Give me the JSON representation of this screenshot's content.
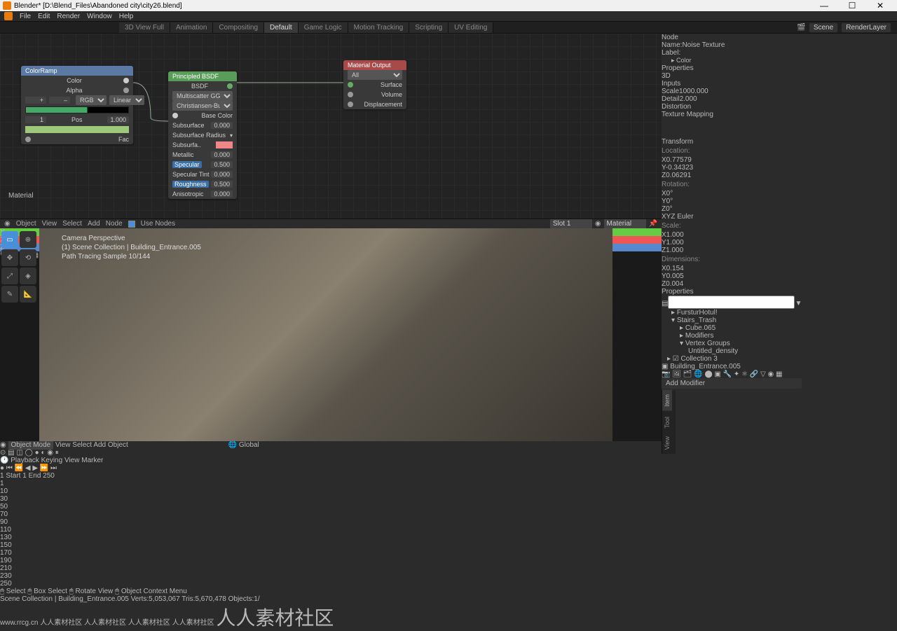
{
  "titlebar": {
    "title": "Blender* [D:\\Blend_Files\\Abandoned city\\city26.blend]",
    "minimize": "—",
    "maximize": "☐",
    "close": "✕"
  },
  "menubar": {
    "file": "File",
    "edit": "Edit",
    "render": "Render",
    "window": "Window",
    "help": "Help"
  },
  "workspaces": {
    "tabs": [
      "3D View Full",
      "Animation",
      "Compositing",
      "Default",
      "Game Logic",
      "Motion Tracking",
      "Scripting",
      "UV Editing"
    ],
    "active": "Default",
    "scene_label": "Scene",
    "scene": "Scene",
    "layer_label": "RenderLayer"
  },
  "nodes": {
    "colorramp": {
      "title": "ColorRamp",
      "color_out": "Color",
      "alpha_out": "Alpha",
      "add": "+",
      "del": "–",
      "mode": "RGB",
      "interp": "Linear",
      "idx": "1",
      "pos_label": "Pos",
      "pos": "1.000",
      "fac": "Fac"
    },
    "principled": {
      "title": "Principled BSDF",
      "bsdf": "BSDF",
      "dist": "Multiscatter GGX",
      "sss": "Christiansen-Burley",
      "base": "Base Color",
      "rows": [
        {
          "l": "Subsurface",
          "v": "0.000"
        },
        {
          "l": "Subsurface Radius",
          "v": ""
        },
        {
          "l": "Subsurfa..",
          "v": "",
          "pink": true
        },
        {
          "l": "Metallic",
          "v": "0.000"
        },
        {
          "l": "Specular",
          "v": "0.500",
          "hl": true
        },
        {
          "l": "Specular Tint",
          "v": "0.000"
        },
        {
          "l": "Roughness",
          "v": "0.500",
          "hl": true
        },
        {
          "l": "Anisotropic",
          "v": "0.000"
        }
      ]
    },
    "matout": {
      "title": "Material Output",
      "target": "All",
      "surface": "Surface",
      "volume": "Volume",
      "disp": "Displacement"
    }
  },
  "material_label": "Material",
  "ne_header": {
    "mode": "Object",
    "view": "View",
    "select": "Select",
    "add": "Add",
    "node": "Node",
    "use_nodes": "Use Nodes",
    "slot": "Slot 1",
    "mat": "Material"
  },
  "viewport": {
    "info1": "Camera Perspective",
    "info2": "(1) Scene Collection | Building_Entrance.005",
    "info3": "Path Tracing Sample 10/144"
  },
  "vp_header": {
    "mode": "Object Mode",
    "view": "View",
    "select": "Select",
    "add": "Add",
    "object": "Object",
    "orient": "Global"
  },
  "sidebar_node": {
    "node": "Node",
    "name_label": "Name:",
    "name": "Noise Texture",
    "label_label": "Label:",
    "color": "Color",
    "properties": "Properties",
    "dim": "3D",
    "inputs": "Inputs",
    "scale_l": "Scale",
    "scale": "1000.000",
    "detail_l": "Detail",
    "detail": "2.000",
    "dist_l": "Distortion",
    "dist": "",
    "texmap": "Texture Mapping"
  },
  "sidebar_item": {
    "transform": "Transform",
    "location": "Location:",
    "rotation": "Rotation:",
    "scale": "Scale:",
    "dims": "Dimensions:",
    "loc": {
      "x": "0.77579",
      "y": "-0.34323",
      "z": "0.06291"
    },
    "rot": {
      "x": "0°",
      "y": "0°",
      "z": "0°"
    },
    "rotmode": "XYZ Euler",
    "scl": {
      "x": "1.000",
      "y": "1.000",
      "z": "1.000"
    },
    "dim": {
      "x": "0.154",
      "y": "0.005",
      "z": "0.004"
    },
    "properties": "Properties"
  },
  "outliner": {
    "search_ph": "",
    "items": [
      {
        "l": "FursturHotul!",
        "d": 0
      },
      {
        "l": "Stairs_Trash",
        "d": 0
      },
      {
        "l": "Cube.065",
        "d": 1
      },
      {
        "l": "Modifiers",
        "d": 1
      },
      {
        "l": "Vertex Groups",
        "d": 1
      },
      {
        "l": "Untitled_density",
        "d": 2
      },
      {
        "l": "Collection 3",
        "d": 0,
        "sel": false
      }
    ],
    "selected": "Building_Entrance.005",
    "add_mod": "Add Modifier"
  },
  "timeline": {
    "playback": "Playback",
    "keying": "Keying",
    "view": "View",
    "marker": "Marker",
    "frame": "1",
    "start_l": "Start",
    "start": "1",
    "end_l": "End",
    "end": "250",
    "ticks": [
      "10",
      "30",
      "50",
      "70",
      "90",
      "110",
      "130",
      "150",
      "170",
      "190",
      "210",
      "230",
      "250"
    ],
    "cursor": "1"
  },
  "statusbar": {
    "select": "Select",
    "box": "Box Select",
    "rotate": "Rotate View",
    "ctx": "Object Context Menu",
    "path": "Scene Collection | Building_Entrance.005",
    "verts": "Verts:5,053,067",
    "tris": "Tris:5,670,478",
    "objs": "Objects:1/"
  },
  "watermarks": {
    "url": "www.rrcg.cn",
    "zh": "人人素材社区"
  }
}
